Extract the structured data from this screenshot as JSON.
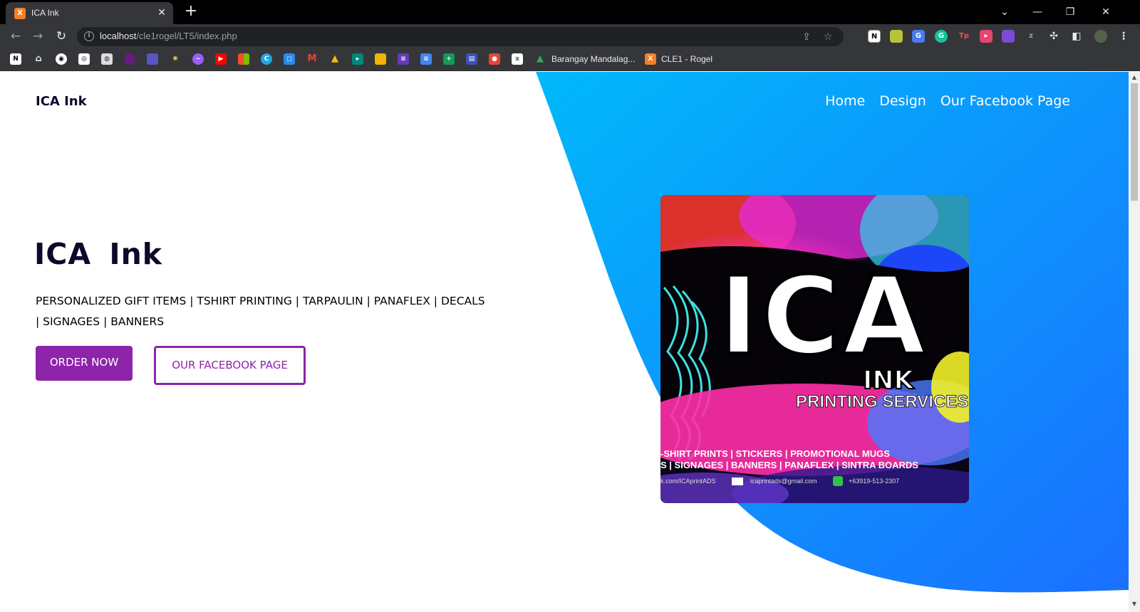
{
  "browser": {
    "tab_title": "ICA Ink",
    "tab_close_icon": "close-icon",
    "url_host": "localhost",
    "url_path": "/cle1rogel/LT5/index.php",
    "bookmarks": [
      {
        "label": "Barangay Mandalag..."
      },
      {
        "label": "CLE1 - Rogel"
      }
    ]
  },
  "page": {
    "brand": "ICA Ink",
    "nav": [
      {
        "label": "Home"
      },
      {
        "label": "Design"
      },
      {
        "label": "Our Facebook Page"
      }
    ],
    "hero_title": "ICA Ink",
    "hero_subtitle": "PERSONALIZED GIFT ITEMS | TSHIRT PRINTING | TARPAULIN | PANAFLEX | DECALS | SIGNAGES | BANNERS",
    "order_button": "ORDER NOW",
    "facebook_button": "OUR FACEBOOK PAGE",
    "logo": {
      "main_text": "ICA",
      "sub_text": "INK",
      "tagline": "PRINTING SERVICES",
      "services_line_1": "-SHIRT PRINTS | STICKERS | PROMOTIONAL MUGS",
      "services_line_2": "S | SIGNAGES | BANNERS | PANAFLEX | SINTRA BOARDS",
      "facebook": "k.com/ICAprintADS",
      "email": "icaprintads@gmail.com",
      "phone": "+63919-513-2307"
    }
  },
  "colors": {
    "accent": "#8e24aa",
    "hero_blue_start": "#00b0f8",
    "hero_blue_end": "#1a74ff",
    "heading": "#0b0a2b"
  }
}
